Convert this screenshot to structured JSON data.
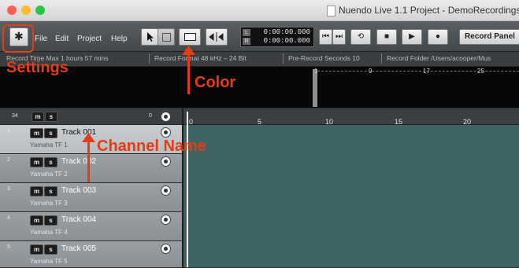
{
  "window": {
    "title": "Nuendo Live 1.1 Project - DemoRecordings"
  },
  "menu": [
    "File",
    "Edit",
    "Project",
    "Help"
  ],
  "counter": {
    "l": "L",
    "r": "R",
    "top": "0:00:00.000",
    "bottom": "0:00:00.000"
  },
  "transport": {
    "record_panel_label": "Record Panel"
  },
  "info_bar": {
    "record_time_max": "Record Time Max   1 hours 57 mins",
    "record_format": "Record Format     48 kHz – 24 Bit",
    "pre_record": "Pre-Record Seconds   10",
    "record_folder": "Record Folder   /Users/acooper/Mus"
  },
  "overview_ticks": [
    "1",
    "9",
    "17",
    "25"
  ],
  "ruler_ticks": [
    "5",
    "10",
    "15",
    "20"
  ],
  "track_header": {
    "count": "34",
    "m_label": "m",
    "s_label": "s",
    "value": "0"
  },
  "tracks": [
    {
      "num": "1",
      "name": "Track 001",
      "input": "Yamaha TF 1"
    },
    {
      "num": "2",
      "name": "Track 002",
      "input": "Yamaha TF 2"
    },
    {
      "num": "3",
      "name": "Track 003",
      "input": "Yamaha TF 3"
    },
    {
      "num": "4",
      "name": "Track 004",
      "input": "Yamaha TF 4"
    },
    {
      "num": "5",
      "name": "Track 005",
      "input": "Yamaha TF 5"
    }
  ],
  "annotations": {
    "settings": "Settings",
    "color": "Color",
    "channel_name": "Channel Name"
  },
  "icons": [
    "gear-icon",
    "arrow-pointer-icon",
    "range-select-icon",
    "color-icon",
    "split-icon",
    "skip-back-icon",
    "skip-forward-icon",
    "loop-icon",
    "stop-icon",
    "play-icon",
    "record-icon",
    "document-icon"
  ],
  "colors": {
    "annotation": "#e43c17",
    "content_bg": "#3e6466",
    "selected_track": "#c9cdd0"
  }
}
